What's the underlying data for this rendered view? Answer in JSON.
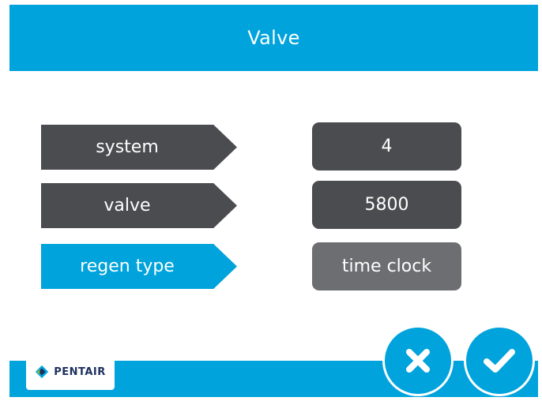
{
  "header": {
    "title": "Valve"
  },
  "rows": [
    {
      "label": "system",
      "value": "4",
      "active": false
    },
    {
      "label": "valve",
      "value": "5800",
      "active": false
    },
    {
      "label": "regen type",
      "value": "time clock",
      "active": true
    }
  ],
  "footer": {
    "brand": "PENTAIR"
  },
  "actions": {
    "cancel_icon": "close-icon",
    "confirm_icon": "check-icon"
  },
  "colors": {
    "accent": "#00a3dc",
    "dark": "#4b4c4f",
    "selected_value": "#6d6e71"
  }
}
